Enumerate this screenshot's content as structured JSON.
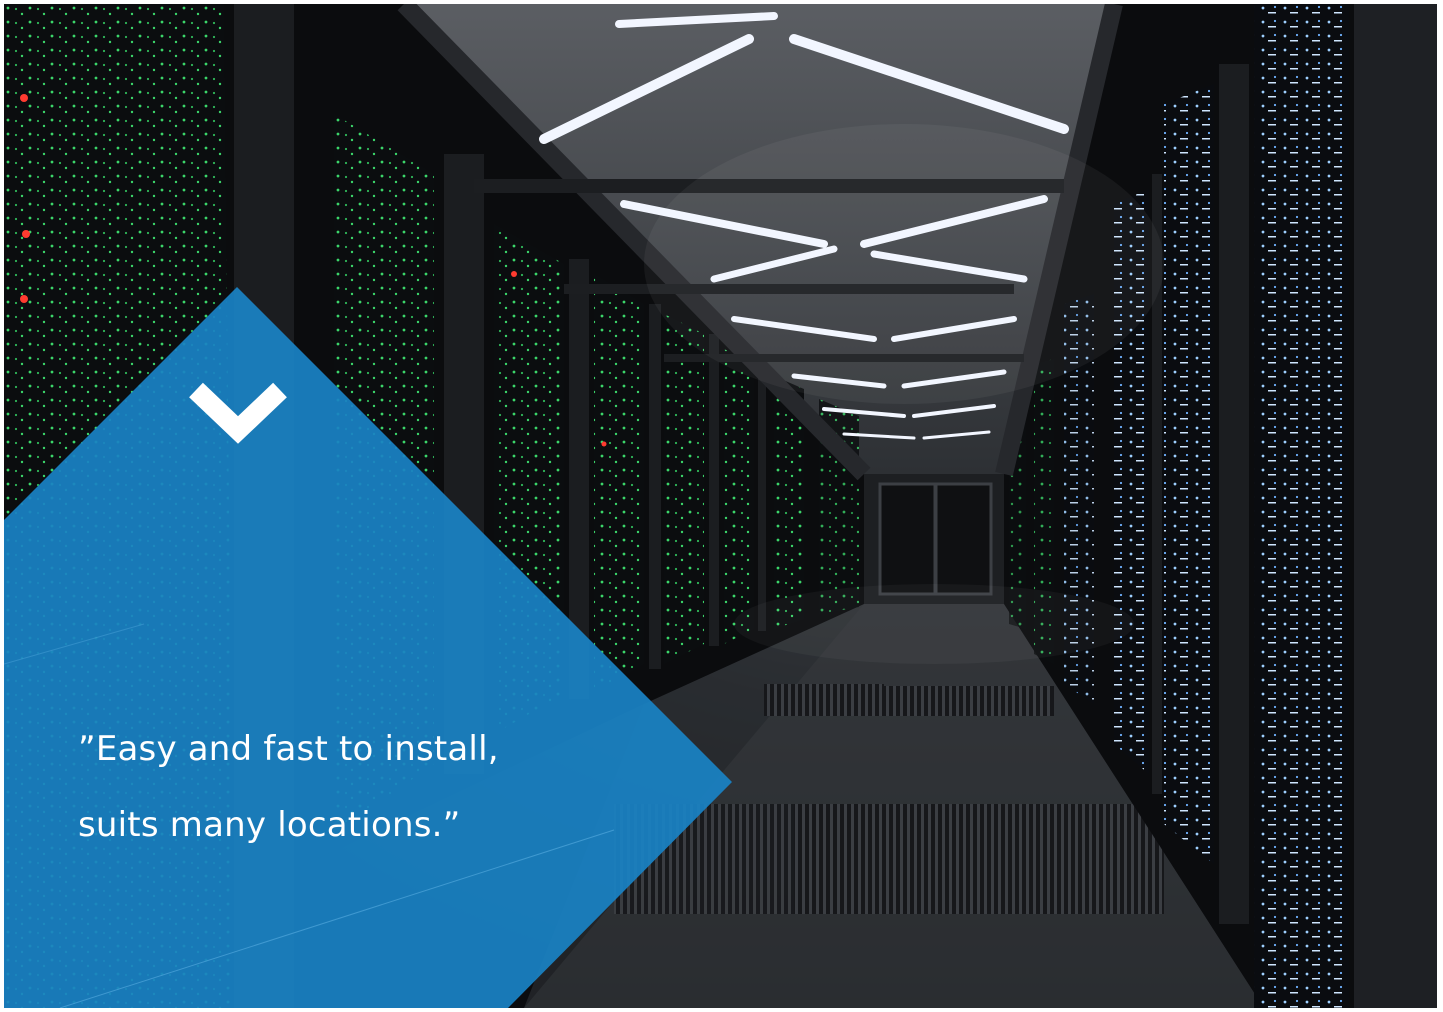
{
  "photo": {
    "subject": "data center corridor with server racks and ceiling lights",
    "colors": {
      "background": "#0d0f12",
      "rack_led_green": "#3bd66a",
      "rack_led_blue": "#8fc6ff",
      "rack_led_red": "#ff3b30",
      "ceiling_light": "#f2f6ff"
    }
  },
  "panel": {
    "color": "#1a82c4",
    "icon": "chevron-down-icon",
    "quote_lines": [
      "”Easy and fast to install,",
      "suits many locations.”"
    ]
  }
}
